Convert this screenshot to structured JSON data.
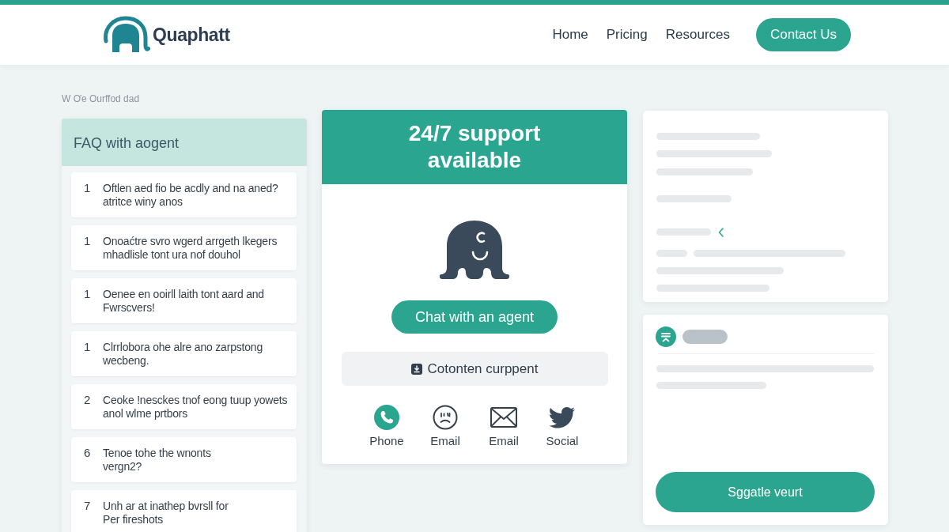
{
  "header": {
    "brand": "Quaphatt",
    "nav": [
      {
        "label": "Home"
      },
      {
        "label": "Pricing"
      },
      {
        "label": "Resources"
      }
    ],
    "cta": "Contact Us"
  },
  "breadcrumb": "W Ơe Ourffod dad",
  "faq": {
    "title": "FAQ with aogent",
    "items": [
      {
        "number": "1",
        "text": "Oftlen aed fio be acdly and na aned?\natritce winy anos"
      },
      {
        "number": "1",
        "text": "Onoaćtre svro wgerd arrgeth lkegers\nmhadlisle tont ura nof douhol"
      },
      {
        "number": "1",
        "text": "Oenee en ooirll laith tont aard and\nFwrscvers!"
      },
      {
        "number": "1",
        "text": "Clrrlobora ohe alre ano zarpstong\nwecbeng."
      },
      {
        "number": "2",
        "text": "Ceoke !nesckes tnof eong tuup yowets\nanol wlme prtbors"
      },
      {
        "number": "6",
        "text": "Tenoe tohe the wnonts\nvergn2?"
      },
      {
        "number": "7",
        "text": "Unh ar at inathep bvrsll for\nPer fireshots"
      }
    ]
  },
  "support_card": {
    "title": "24/7 support available",
    "chat_button": "Chat with an agent",
    "secondary_button": "Cotonten curppent",
    "contacts": [
      {
        "kind": "phone",
        "label": "Phone"
      },
      {
        "kind": "face",
        "label": "Email"
      },
      {
        "kind": "envelope",
        "label": "Email"
      },
      {
        "kind": "bird",
        "label": "Social"
      }
    ]
  },
  "side_panel": {
    "button": "Sggatle veurt"
  }
}
